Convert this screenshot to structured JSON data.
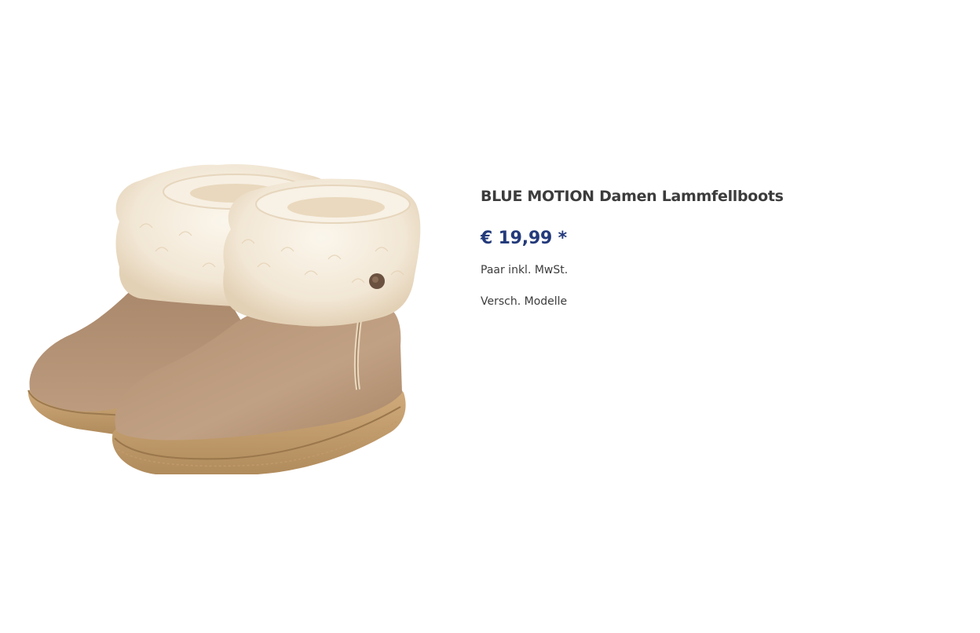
{
  "product": {
    "title": "BLUE MOTION Damen Lammfellboots",
    "price": "€ 19,99 *",
    "unit_note": "Paar inkl. MwSt.",
    "variants_note": "Versch. Modelle",
    "image": {
      "subject": "boots-image",
      "colors": {
        "suede": "#b9987a",
        "suede_shadow": "#9a7a5d",
        "sole": "#c9a374",
        "sole_dark": "#a98656",
        "fur": "#f4ebdc",
        "fur_shadow": "#e2d2b9",
        "button": "#6b5240"
      }
    }
  },
  "colors": {
    "title": "#3c3c3c",
    "price": "#233a7b",
    "text": "#3c3c3c",
    "background": "#ffffff"
  }
}
